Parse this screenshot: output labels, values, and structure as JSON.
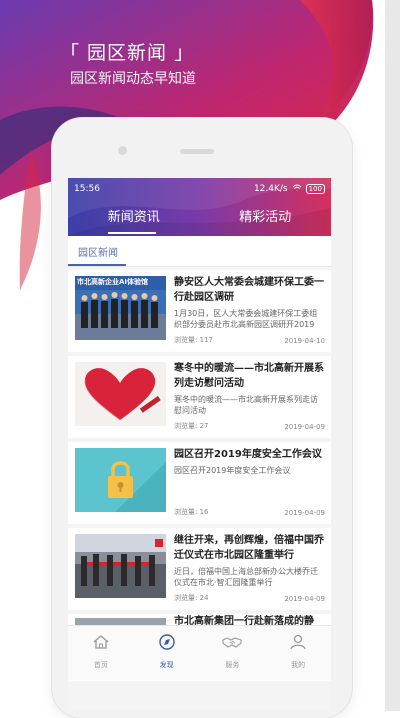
{
  "promo": {
    "title": "「 园区新闻 」",
    "subtitle": "园区新闻动态早知道"
  },
  "status_bar": {
    "time": "15:56",
    "speed": "12.4K/s",
    "battery": "100"
  },
  "tabs": [
    {
      "label": "新闻资讯",
      "active": true
    },
    {
      "label": "精彩活动",
      "active": false
    }
  ],
  "subtab": {
    "label": "园区新闻"
  },
  "news": [
    {
      "title": "静安区人大常委会城建环保工委一行赴园区调研",
      "summary": "1月30日，区人大常委会城建环保工委组织部分委员赴市北高新园区调研开2019",
      "views": "浏览量: 117",
      "date": "2019-04-10",
      "thumb_text": "市北高新企业AI体验馆"
    },
    {
      "title": "寒冬中的暖流——市北高新开展系列走访慰问活动",
      "summary": "寒冬中的暖流——市北高新开展系列走访慰问活动",
      "views": "浏览量: 27",
      "date": "2019-04-09"
    },
    {
      "title": "园区召开2019年度安全工作会议",
      "summary": "园区召开2019年度安全工作会议",
      "views": "浏览量: 16",
      "date": "2019-04-09"
    },
    {
      "title": "继往开来，再创辉煌，倍福中国乔迁仪式在市北园区隆重举行",
      "summary": "近日，倍福中国上海总部新办公大楼乔迁仪式在市北·智汇园隆重举行",
      "views": "浏览量: 24",
      "date": "2019-04-09"
    },
    {
      "title": "市北高新集团一行赴新落成的静",
      "summary": "",
      "views": "",
      "date": ""
    }
  ],
  "bottom_nav": [
    {
      "label": "首页",
      "icon": "home-icon"
    },
    {
      "label": "发现",
      "icon": "compass-icon"
    },
    {
      "label": "服务",
      "icon": "handshake-icon"
    },
    {
      "label": "我的",
      "icon": "user-icon"
    }
  ],
  "colors": {
    "accent": "#3c5aa6",
    "brand_red": "#d6203c",
    "brand_purple": "#5b3aa0"
  }
}
